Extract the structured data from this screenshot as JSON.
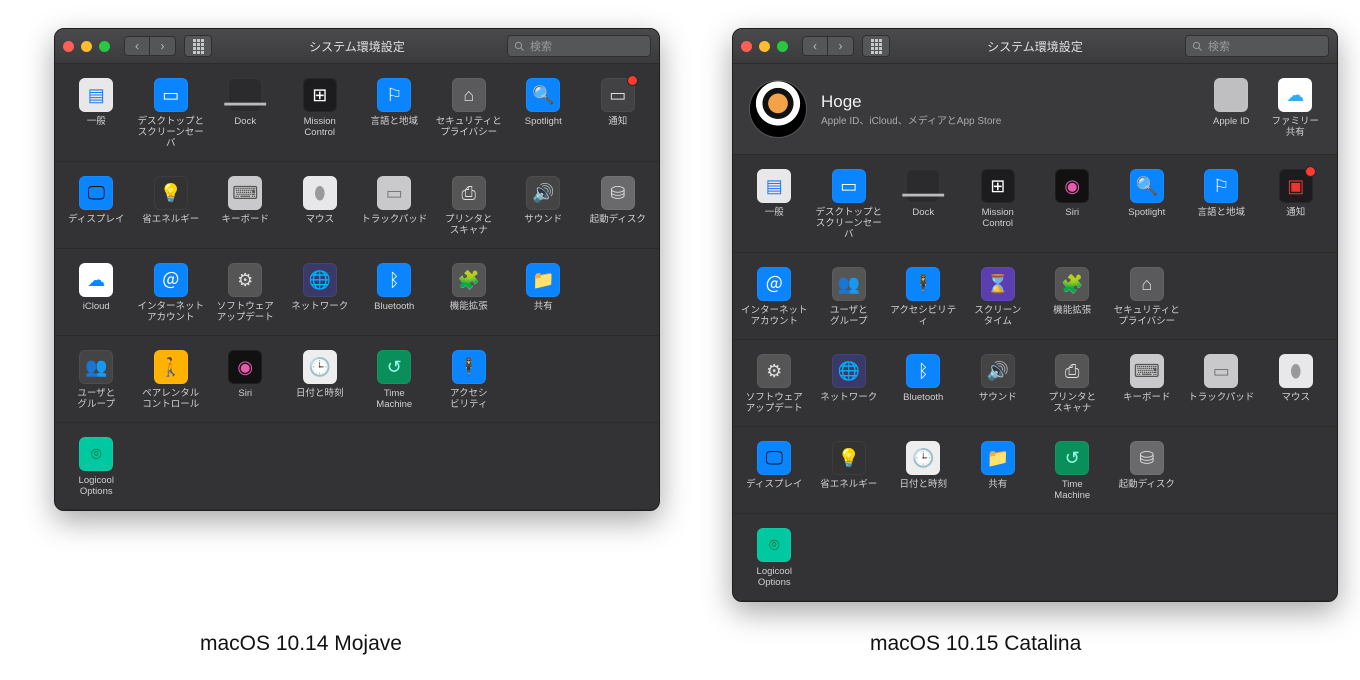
{
  "captions": {
    "mojave": "macOS 10.14 Mojave",
    "catalina": "macOS 10.15 Catalina"
  },
  "common": {
    "window_title": "システム環境設定",
    "search_placeholder": "検索"
  },
  "mojave": {
    "rows": [
      [
        {
          "id": "general",
          "label": "一般",
          "bg": "#e8e8ea",
          "fg": "#1b7cf5",
          "glyph": "▤"
        },
        {
          "id": "desktop",
          "label": "デスクトップと\nスクリーンセーバ",
          "bg": "#0a84ff",
          "fg": "#fff",
          "glyph": "▭"
        },
        {
          "id": "dock",
          "label": "Dock",
          "bg": "#2b2b2d",
          "fg": "#bbb",
          "glyph": "▁▁▁"
        },
        {
          "id": "mission",
          "label": "Mission\nControl",
          "bg": "#1c1c1e",
          "fg": "#fff",
          "glyph": "⊞"
        },
        {
          "id": "lang",
          "label": "言語と地域",
          "bg": "#0a84ff",
          "fg": "#fff",
          "glyph": "⚐"
        },
        {
          "id": "security",
          "label": "セキュリティと\nプライバシー",
          "bg": "#5a5a5c",
          "fg": "#ddd",
          "glyph": "⌂"
        },
        {
          "id": "spotlight",
          "label": "Spotlight",
          "bg": "#0a84ff",
          "fg": "#fff",
          "glyph": "🔍"
        },
        {
          "id": "notifications",
          "label": "通知",
          "bg": "#424244",
          "fg": "#ddd",
          "glyph": "▭",
          "badge": true
        }
      ],
      [
        {
          "id": "displays",
          "label": "ディスプレイ",
          "bg": "#0a84ff",
          "fg": "#111",
          "glyph": "🖵"
        },
        {
          "id": "energy",
          "label": "省エネルギー",
          "bg": "#333",
          "fg": "#ffd54a",
          "glyph": "💡"
        },
        {
          "id": "keyboard",
          "label": "キーボード",
          "bg": "#c9c9cb",
          "fg": "#555",
          "glyph": "⌨"
        },
        {
          "id": "mouse",
          "label": "マウス",
          "bg": "#e8e8ea",
          "fg": "#999",
          "glyph": "⬮"
        },
        {
          "id": "trackpad",
          "label": "トラックパッド",
          "bg": "#c9c9cb",
          "fg": "#777",
          "glyph": "▭"
        },
        {
          "id": "printers",
          "label": "プリンタと\nスキャナ",
          "bg": "#555",
          "fg": "#ddd",
          "glyph": "⎙"
        },
        {
          "id": "sound",
          "label": "サウンド",
          "bg": "#444",
          "fg": "#ccc",
          "glyph": "🔊"
        },
        {
          "id": "startup",
          "label": "起動ディスク",
          "bg": "#6a6a6c",
          "fg": "#ddd",
          "glyph": "⛁"
        }
      ],
      [
        {
          "id": "icloud",
          "label": "iCloud",
          "bg": "#ffffff",
          "fg": "#0a84ff",
          "glyph": "☁"
        },
        {
          "id": "internet",
          "label": "インターネット\nアカウント",
          "bg": "#0a84ff",
          "fg": "#fff",
          "glyph": "＠"
        },
        {
          "id": "swupdate",
          "label": "ソフトウェア\nアップデート",
          "bg": "#555",
          "fg": "#ddd",
          "glyph": "⚙"
        },
        {
          "id": "network",
          "label": "ネットワーク",
          "bg": "#3a3a6a",
          "fg": "#9bd",
          "glyph": "🌐"
        },
        {
          "id": "bluetooth",
          "label": "Bluetooth",
          "bg": "#0a84ff",
          "fg": "#fff",
          "glyph": "ᛒ"
        },
        {
          "id": "extensions",
          "label": "機能拡張",
          "bg": "#555",
          "fg": "#333",
          "glyph": "🧩"
        },
        {
          "id": "sharing",
          "label": "共有",
          "bg": "#0a84ff",
          "fg": "#ffd54a",
          "glyph": "📁"
        }
      ],
      [
        {
          "id": "users",
          "label": "ユーザと\nグループ",
          "bg": "#444",
          "fg": "#222",
          "glyph": "👥"
        },
        {
          "id": "parental",
          "label": "ペアレンタル\nコントロール",
          "bg": "#ffb300",
          "fg": "#5a3",
          "glyph": "🚶"
        },
        {
          "id": "siri",
          "label": "Siri",
          "bg": "#111",
          "fg": "#e85aad",
          "glyph": "◉"
        },
        {
          "id": "datetime",
          "label": "日付と時刻",
          "bg": "#eee",
          "fg": "#333",
          "glyph": "🕒"
        },
        {
          "id": "timemachine",
          "label": "Time\nMachine",
          "bg": "#0a8f5a",
          "fg": "#9fe",
          "glyph": "↺"
        },
        {
          "id": "a11y",
          "label": "アクセシ\nビリティ",
          "bg": "#0a84ff",
          "fg": "#fff",
          "glyph": "🕴"
        }
      ],
      [
        {
          "id": "logicool",
          "label": "Logicool Options",
          "bg": "#00c8a0",
          "fg": "#063",
          "glyph": "⌾"
        }
      ]
    ]
  },
  "catalina": {
    "account": {
      "name": "Hoge",
      "sub": "Apple ID、iCloud、メディアとApp Store",
      "right": [
        {
          "id": "appleid",
          "label": "Apple ID",
          "bg": "#bfbfc1",
          "fg": "#fff",
          "glyph": ""
        },
        {
          "id": "family",
          "label": "ファミリー\n共有",
          "bg": "#ffffff",
          "fg": "#34aaf2",
          "glyph": "☁"
        }
      ]
    },
    "rows": [
      [
        {
          "id": "general",
          "label": "一般",
          "bg": "#e8e8ea",
          "fg": "#1b7cf5",
          "glyph": "▤"
        },
        {
          "id": "desktop",
          "label": "デスクトップと\nスクリーンセーバ",
          "bg": "#0a84ff",
          "fg": "#fff",
          "glyph": "▭"
        },
        {
          "id": "dock",
          "label": "Dock",
          "bg": "#2b2b2d",
          "fg": "#bbb",
          "glyph": "▁▁▁"
        },
        {
          "id": "mission",
          "label": "Mission\nControl",
          "bg": "#1c1c1e",
          "fg": "#fff",
          "glyph": "⊞"
        },
        {
          "id": "siri",
          "label": "Siri",
          "bg": "#111",
          "fg": "#e85aad",
          "glyph": "◉"
        },
        {
          "id": "spotlight",
          "label": "Spotlight",
          "bg": "#0a84ff",
          "fg": "#fff",
          "glyph": "🔍"
        },
        {
          "id": "lang",
          "label": "言語と地域",
          "bg": "#0a84ff",
          "fg": "#fff",
          "glyph": "⚐"
        },
        {
          "id": "notifications",
          "label": "通知",
          "bg": "#1c1c1e",
          "fg": "#e33",
          "glyph": "▣",
          "badge": true
        }
      ],
      [
        {
          "id": "internet",
          "label": "インターネット\nアカウント",
          "bg": "#0a84ff",
          "fg": "#fff",
          "glyph": "＠"
        },
        {
          "id": "users",
          "label": "ユーザと\nグループ",
          "bg": "#555",
          "fg": "#ddd",
          "glyph": "👥"
        },
        {
          "id": "a11y",
          "label": "アクセシビリティ",
          "bg": "#0a84ff",
          "fg": "#fff",
          "glyph": "🕴"
        },
        {
          "id": "screentime",
          "label": "スクリーン\nタイム",
          "bg": "#5a3fb0",
          "fg": "#fff",
          "glyph": "⌛"
        },
        {
          "id": "extensions",
          "label": "機能拡張",
          "bg": "#555",
          "fg": "#333",
          "glyph": "🧩"
        },
        {
          "id": "security",
          "label": "セキュリティと\nプライバシー",
          "bg": "#5a5a5c",
          "fg": "#ddd",
          "glyph": "⌂"
        }
      ],
      [
        {
          "id": "swupdate",
          "label": "ソフトウェア\nアップデート",
          "bg": "#555",
          "fg": "#ddd",
          "glyph": "⚙"
        },
        {
          "id": "network",
          "label": "ネットワーク",
          "bg": "#3a3a6a",
          "fg": "#9bd",
          "glyph": "🌐"
        },
        {
          "id": "bluetooth",
          "label": "Bluetooth",
          "bg": "#0a84ff",
          "fg": "#fff",
          "glyph": "ᛒ"
        },
        {
          "id": "sound",
          "label": "サウンド",
          "bg": "#444",
          "fg": "#ccc",
          "glyph": "🔊"
        },
        {
          "id": "printers",
          "label": "プリンタと\nスキャナ",
          "bg": "#555",
          "fg": "#ddd",
          "glyph": "⎙"
        },
        {
          "id": "keyboard",
          "label": "キーボード",
          "bg": "#c9c9cb",
          "fg": "#555",
          "glyph": "⌨"
        },
        {
          "id": "trackpad",
          "label": "トラックパッド",
          "bg": "#c9c9cb",
          "fg": "#777",
          "glyph": "▭"
        },
        {
          "id": "mouse",
          "label": "マウス",
          "bg": "#e8e8ea",
          "fg": "#999",
          "glyph": "⬮"
        }
      ],
      [
        {
          "id": "displays",
          "label": "ディスプレイ",
          "bg": "#0a84ff",
          "fg": "#111",
          "glyph": "🖵"
        },
        {
          "id": "energy",
          "label": "省エネルギー",
          "bg": "#333",
          "fg": "#ffd54a",
          "glyph": "💡"
        },
        {
          "id": "datetime",
          "label": "日付と時刻",
          "bg": "#eee",
          "fg": "#333",
          "glyph": "🕒"
        },
        {
          "id": "sharing",
          "label": "共有",
          "bg": "#0a84ff",
          "fg": "#ffd54a",
          "glyph": "📁"
        },
        {
          "id": "timemachine",
          "label": "Time\nMachine",
          "bg": "#0a8f5a",
          "fg": "#9fe",
          "glyph": "↺"
        },
        {
          "id": "startup",
          "label": "起動ディスク",
          "bg": "#6a6a6c",
          "fg": "#ddd",
          "glyph": "⛁"
        }
      ],
      [
        {
          "id": "logicool",
          "label": "Logicool Options",
          "bg": "#00c8a0",
          "fg": "#063",
          "glyph": "⌾"
        }
      ]
    ]
  }
}
